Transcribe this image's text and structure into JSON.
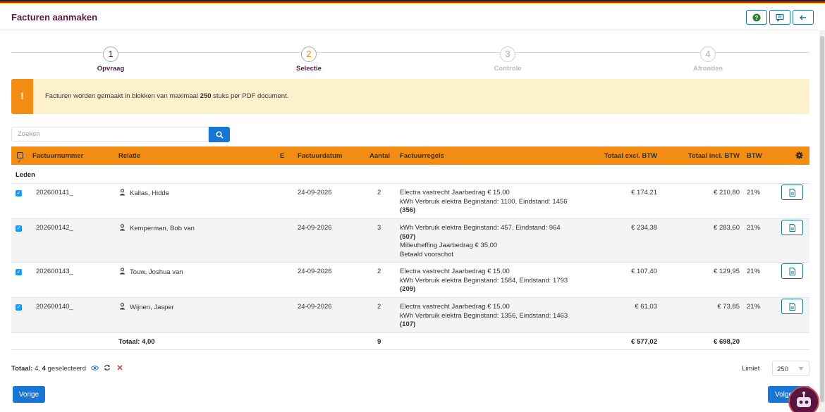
{
  "header": {
    "title": "Facturen aanmaken"
  },
  "steps": [
    {
      "num": "1",
      "label": "Opvraag"
    },
    {
      "num": "2",
      "label": "Selectie"
    },
    {
      "num": "3",
      "label": "Controle"
    },
    {
      "num": "4",
      "label": "Afronden"
    }
  ],
  "alert": {
    "icon": "!",
    "prefix": "Facturen worden gemaakt in blokken van maximaal ",
    "count": "250",
    "suffix": " stuks per PDF document."
  },
  "search": {
    "placeholder": "Zoeken"
  },
  "table": {
    "headers": {
      "factuurnummer": "Factuurnummer",
      "relatie": "Relatie",
      "e": "E",
      "factuurdatum": "Factuurdatum",
      "aantal": "Aantal",
      "factuurregels": "Factuurregels",
      "excl": "Totaal excl. BTW",
      "incl": "Totaal incl. BTW",
      "btw": "BTW"
    },
    "group": "Leden",
    "rows": [
      {
        "nummer": "202600141_",
        "relatie": "Kallas, Hidde",
        "datum": "24-09-2026",
        "aantal": "2",
        "regels": [
          "Electra vastrecht Jaarbedrag € 15,00",
          "kWh Verbruik elektra Beginstand: 1100, Eindstand: 1456",
          "(356)"
        ],
        "excl": "€ 174,21",
        "incl": "€ 210,80",
        "btw": "21%"
      },
      {
        "nummer": "202600142_",
        "relatie": "Kemperman, Bob van",
        "datum": "24-09-2026",
        "aantal": "3",
        "regels": [
          "kWh Verbruik elektra Beginstand: 457, Eindstand: 964",
          "(507)",
          "Milieuheffing Jaarbedrag € 35,00",
          "Betaald voorschot"
        ],
        "excl": "€ 234,38",
        "incl": "€ 283,60",
        "btw": "21%"
      },
      {
        "nummer": "202600143_",
        "relatie": "Touw, Joshua van",
        "datum": "24-09-2026",
        "aantal": "2",
        "regels": [
          "Electra vastrecht Jaarbedrag € 15,00",
          "kWh Verbruik elektra Beginstand: 1584, Eindstand: 1793",
          "(209)"
        ],
        "excl": "€ 107,40",
        "incl": "€ 129,95",
        "btw": "21%"
      },
      {
        "nummer": "202600140_",
        "relatie": "Wijnen, Jasper",
        "datum": "24-09-2026",
        "aantal": "2",
        "regels": [
          "Electra vastrecht Jaarbedrag € 15,00",
          "kWh Verbruik elektra Beginstand: 1356, Eindstand: 1463",
          "(107)"
        ],
        "excl": "€ 61,03",
        "incl": "€ 73,85",
        "btw": "21%"
      }
    ],
    "totals": {
      "label": "Totaal: 4,00",
      "aantal": "9",
      "excl": "€ 577,02",
      "incl": "€ 698,20"
    }
  },
  "footer": {
    "totaal_label": "Totaal:",
    "totaal_value": "4,",
    "selected_count": "4",
    "selected_label": "geselecteerd",
    "limiet_label": "Limiet",
    "limiet_value": "250"
  },
  "buttons": {
    "vorige": "Vorige",
    "volgende": "Volge"
  },
  "colors": {
    "accent": "#f28c13",
    "primary": "#1976d2",
    "brand": "#5a1640"
  }
}
